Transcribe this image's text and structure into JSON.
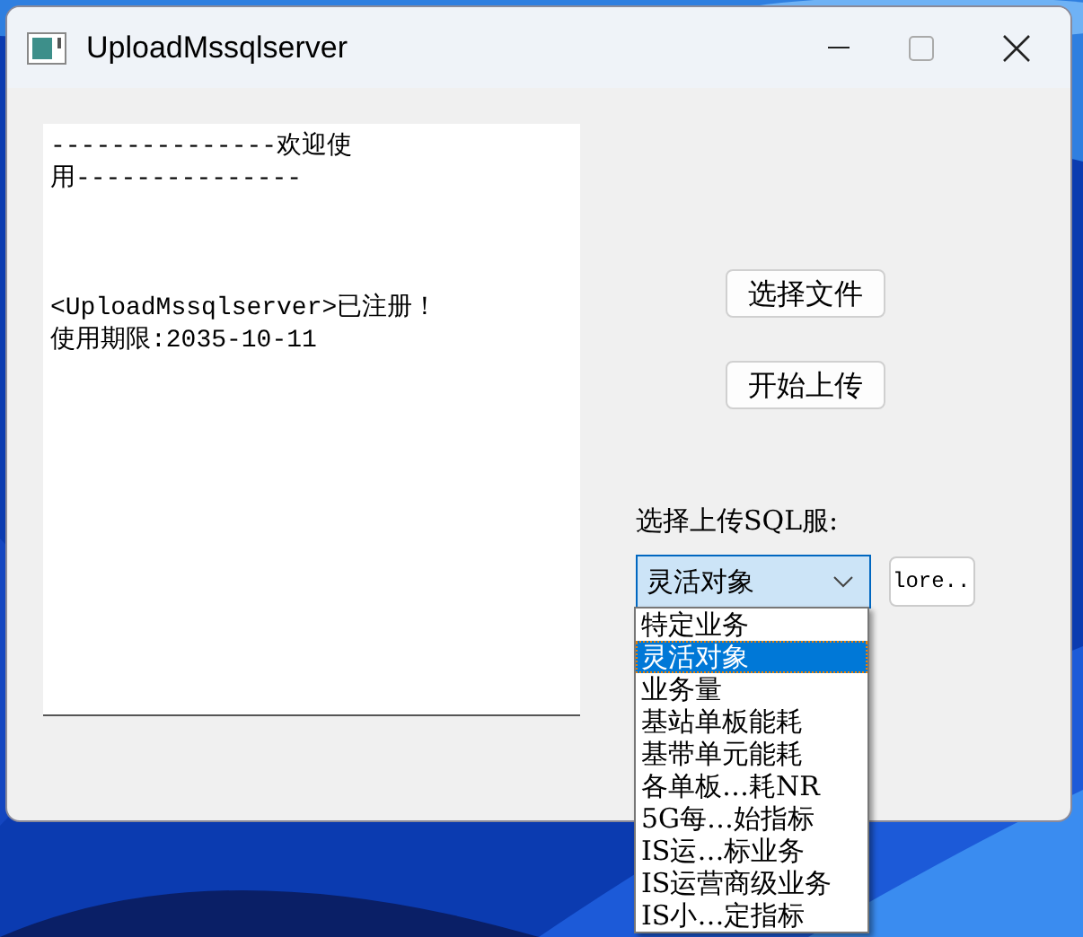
{
  "window": {
    "title": "UploadMssqlserver"
  },
  "log_lines": [
    "---------------欢迎使",
    "用---------------",
    "<UploadMssqlserver>已注册！",
    "使用期限:2035-10-11"
  ],
  "buttons": [
    "选择文件",
    "开始上传"
  ],
  "server_label": "选择上传SQL服:",
  "server_combo": {
    "value": "灵活对象",
    "expanded": true,
    "options": [
      {
        "label": "特定业务",
        "selected": false
      },
      {
        "label": "灵活对象",
        "selected": true
      },
      {
        "label": "业务量",
        "selected": false
      },
      {
        "label": "基站单板能耗",
        "selected": false
      },
      {
        "label": "基带单元能耗",
        "selected": false
      },
      {
        "label": "各单板…耗NR",
        "selected": false
      },
      {
        "label": "5G每…始指标",
        "selected": false
      },
      {
        "label": "IS运…标业务",
        "selected": false
      },
      {
        "label": "IS运营商级业务",
        "selected": false
      },
      {
        "label": "IS小…定指标",
        "selected": false
      }
    ]
  },
  "more_button": "lore.."
}
